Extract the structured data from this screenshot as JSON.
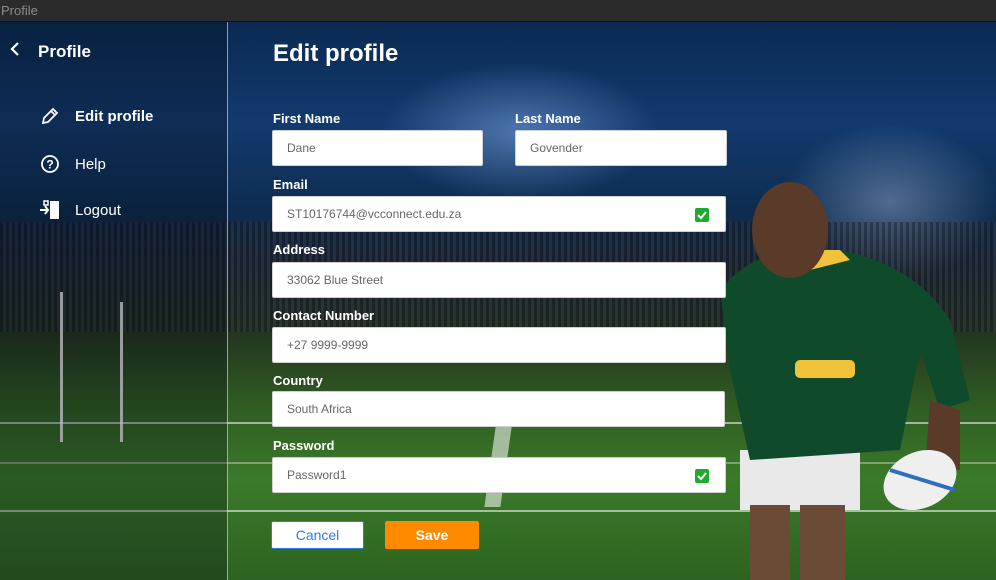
{
  "window": {
    "title": "Profile"
  },
  "sidebar": {
    "title": "Profile",
    "items": [
      {
        "label": "Edit profile",
        "icon": "pencil-icon"
      },
      {
        "label": "Help",
        "icon": "help-icon"
      },
      {
        "label": "Logout",
        "icon": "logout-icon"
      }
    ]
  },
  "form": {
    "title": "Edit profile",
    "first_name": {
      "label": "First Name",
      "value": "Dane"
    },
    "last_name": {
      "label": "Last Name",
      "value": "Govender"
    },
    "email": {
      "label": "Email",
      "value": "ST10176744@vcconnect.edu.za",
      "checked": true
    },
    "address": {
      "label": "Address",
      "value": "33062 Blue Street"
    },
    "contact": {
      "label": "Contact Number",
      "value": "+27 9999-9999"
    },
    "country": {
      "label": "Country",
      "value": "South Africa"
    },
    "password": {
      "label": "Password",
      "value": "Password1",
      "checked": true
    },
    "cancel_label": "Cancel",
    "save_label": "Save"
  },
  "colors": {
    "accent": "#ff8a00",
    "link": "#2d7be5",
    "check": "#1faa2e"
  }
}
